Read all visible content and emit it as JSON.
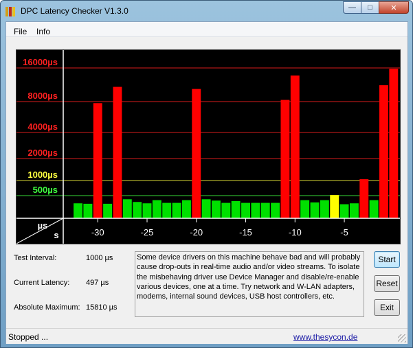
{
  "window": {
    "title": "DPC Latency Checker V1.3.0"
  },
  "menu": {
    "file": "File",
    "info": "Info"
  },
  "chart_data": {
    "type": "bar",
    "ylabel": "µs",
    "xlabel": "s",
    "y_ticks": [
      {
        "label": "16000µs",
        "value": 16000,
        "color": "#ff2020"
      },
      {
        "label": "8000µs",
        "value": 8000,
        "color": "#ff2020"
      },
      {
        "label": "4000µs",
        "value": 4000,
        "color": "#ff2020"
      },
      {
        "label": "2000µs",
        "value": 2000,
        "color": "#ff2020"
      },
      {
        "label": "1000µs",
        "value": 1000,
        "color": "#ffff40"
      },
      {
        "label": "500µs",
        "value": 500,
        "color": "#40ff40"
      }
    ],
    "x_ticks": [
      {
        "label": "-30",
        "value": -30
      },
      {
        "label": "-25",
        "value": -25
      },
      {
        "label": "-20",
        "value": -20
      },
      {
        "label": "-15",
        "value": -15
      },
      {
        "label": "-10",
        "value": -10
      },
      {
        "label": "-5",
        "value": -5
      }
    ],
    "x_range": [
      -33,
      0
    ],
    "bar_width_s": 0.9,
    "bars": [
      {
        "x": -32,
        "value": 330
      },
      {
        "x": -31,
        "value": 320
      },
      {
        "x": -30,
        "value": 7800
      },
      {
        "x": -29,
        "value": 320
      },
      {
        "x": -28,
        "value": 11500
      },
      {
        "x": -27,
        "value": 420
      },
      {
        "x": -26,
        "value": 360
      },
      {
        "x": -25,
        "value": 330
      },
      {
        "x": -24,
        "value": 400
      },
      {
        "x": -23,
        "value": 340
      },
      {
        "x": -22,
        "value": 340
      },
      {
        "x": -21,
        "value": 400
      },
      {
        "x": -20,
        "value": 11000
      },
      {
        "x": -19,
        "value": 420
      },
      {
        "x": -18,
        "value": 390
      },
      {
        "x": -17,
        "value": 340
      },
      {
        "x": -16,
        "value": 380
      },
      {
        "x": -15,
        "value": 340
      },
      {
        "x": -14,
        "value": 340
      },
      {
        "x": -13,
        "value": 340
      },
      {
        "x": -12,
        "value": 340
      },
      {
        "x": -11,
        "value": 8400
      },
      {
        "x": -10,
        "value": 14200
      },
      {
        "x": -9,
        "value": 400
      },
      {
        "x": -8,
        "value": 350
      },
      {
        "x": -7,
        "value": 400
      },
      {
        "x": -6,
        "value": 520
      },
      {
        "x": -5,
        "value": 310
      },
      {
        "x": -4,
        "value": 330
      },
      {
        "x": -3,
        "value": 1060
      },
      {
        "x": -2,
        "value": 400
      },
      {
        "x": -1,
        "value": 11900
      },
      {
        "x": 0,
        "value": 15810
      }
    ],
    "colors": {
      "green": "#00e000",
      "yellow": "#ffff00",
      "red": "#ff0000"
    }
  },
  "info": {
    "test_interval_label": "Test Interval:",
    "test_interval_value": "1000 µs",
    "current_latency_label": "Current Latency:",
    "current_latency_value": "497 µs",
    "absolute_max_label": "Absolute Maximum:",
    "absolute_max_value": "15810 µs"
  },
  "description": "Some device drivers on this machine behave bad and will probably cause drop-outs in real-time audio and/or video streams. To isolate the misbehaving driver use Device Manager and disable/re-enable various devices, one at a time. Try network and W-LAN adapters, modems, internal sound devices, USB host controllers, etc.",
  "buttons": {
    "start": "Start",
    "reset": "Reset",
    "exit": "Exit"
  },
  "status": {
    "text": "Stopped ...",
    "link": "www.thesycon.de"
  }
}
